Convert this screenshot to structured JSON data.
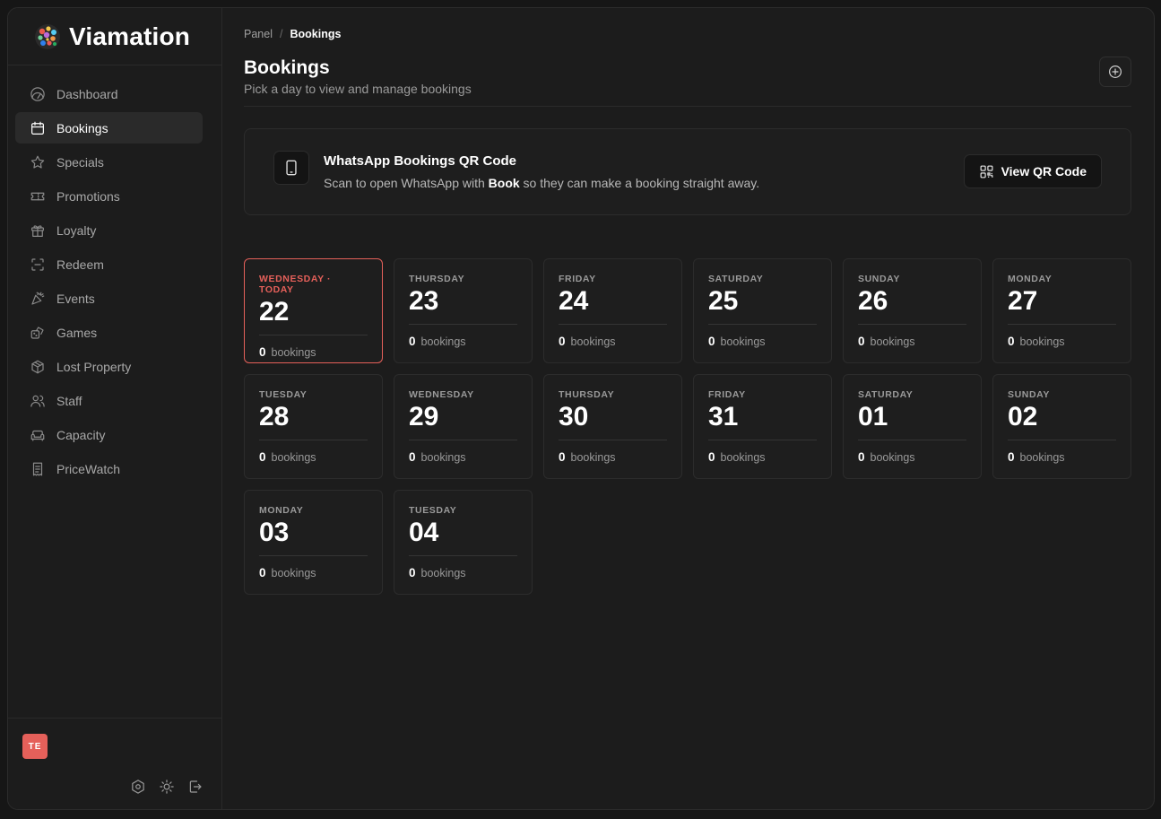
{
  "brand": {
    "name": "Viamation"
  },
  "sidebar": {
    "items": [
      {
        "label": "Dashboard",
        "icon": "gauge-icon",
        "active": false
      },
      {
        "label": "Bookings",
        "icon": "calendar-icon",
        "active": true
      },
      {
        "label": "Specials",
        "icon": "star-icon",
        "active": false
      },
      {
        "label": "Promotions",
        "icon": "ticket-icon",
        "active": false
      },
      {
        "label": "Loyalty",
        "icon": "gift-icon",
        "active": false
      },
      {
        "label": "Redeem",
        "icon": "scan-icon",
        "active": false
      },
      {
        "label": "Events",
        "icon": "party-popper-icon",
        "active": false
      },
      {
        "label": "Games",
        "icon": "dice-icon",
        "active": false
      },
      {
        "label": "Lost Property",
        "icon": "box-icon",
        "active": false
      },
      {
        "label": "Staff",
        "icon": "users-icon",
        "active": false
      },
      {
        "label": "Capacity",
        "icon": "sofa-icon",
        "active": false
      },
      {
        "label": "PriceWatch",
        "icon": "receipt-icon",
        "active": false
      }
    ],
    "footer": {
      "avatar_initials": "TE",
      "icons": [
        "settings-icon",
        "sun-icon",
        "logout-icon"
      ]
    }
  },
  "breadcrumb": {
    "root": "Panel",
    "separator": "/",
    "current": "Bookings"
  },
  "header": {
    "title": "Bookings",
    "subtitle": "Pick a day to view and manage bookings"
  },
  "qr_card": {
    "title": "WhatsApp Bookings QR Code",
    "desc_before": "Scan to open WhatsApp with ",
    "desc_bold": "Book",
    "desc_after": " so they can make a booking straight away.",
    "button_label": "View QR Code"
  },
  "days": [
    {
      "name": "WEDNESDAY · TODAY",
      "num": "22",
      "count": "0",
      "unit": "bookings",
      "today": true
    },
    {
      "name": "THURSDAY",
      "num": "23",
      "count": "0",
      "unit": "bookings"
    },
    {
      "name": "FRIDAY",
      "num": "24",
      "count": "0",
      "unit": "bookings"
    },
    {
      "name": "SATURDAY",
      "num": "25",
      "count": "0",
      "unit": "bookings"
    },
    {
      "name": "SUNDAY",
      "num": "26",
      "count": "0",
      "unit": "bookings"
    },
    {
      "name": "MONDAY",
      "num": "27",
      "count": "0",
      "unit": "bookings"
    },
    {
      "name": "TUESDAY",
      "num": "28",
      "count": "0",
      "unit": "bookings"
    },
    {
      "name": "WEDNESDAY",
      "num": "29",
      "count": "0",
      "unit": "bookings"
    },
    {
      "name": "THURSDAY",
      "num": "30",
      "count": "0",
      "unit": "bookings"
    },
    {
      "name": "FRIDAY",
      "num": "31",
      "count": "0",
      "unit": "bookings"
    },
    {
      "name": "SATURDAY",
      "num": "01",
      "count": "0",
      "unit": "bookings"
    },
    {
      "name": "SUNDAY",
      "num": "02",
      "count": "0",
      "unit": "bookings"
    },
    {
      "name": "MONDAY",
      "num": "03",
      "count": "0",
      "unit": "bookings"
    },
    {
      "name": "TUESDAY",
      "num": "04",
      "count": "0",
      "unit": "bookings"
    }
  ],
  "colors": {
    "accent": "#e5605a",
    "background": "#1c1c1c",
    "card": "#1e1e1e"
  }
}
